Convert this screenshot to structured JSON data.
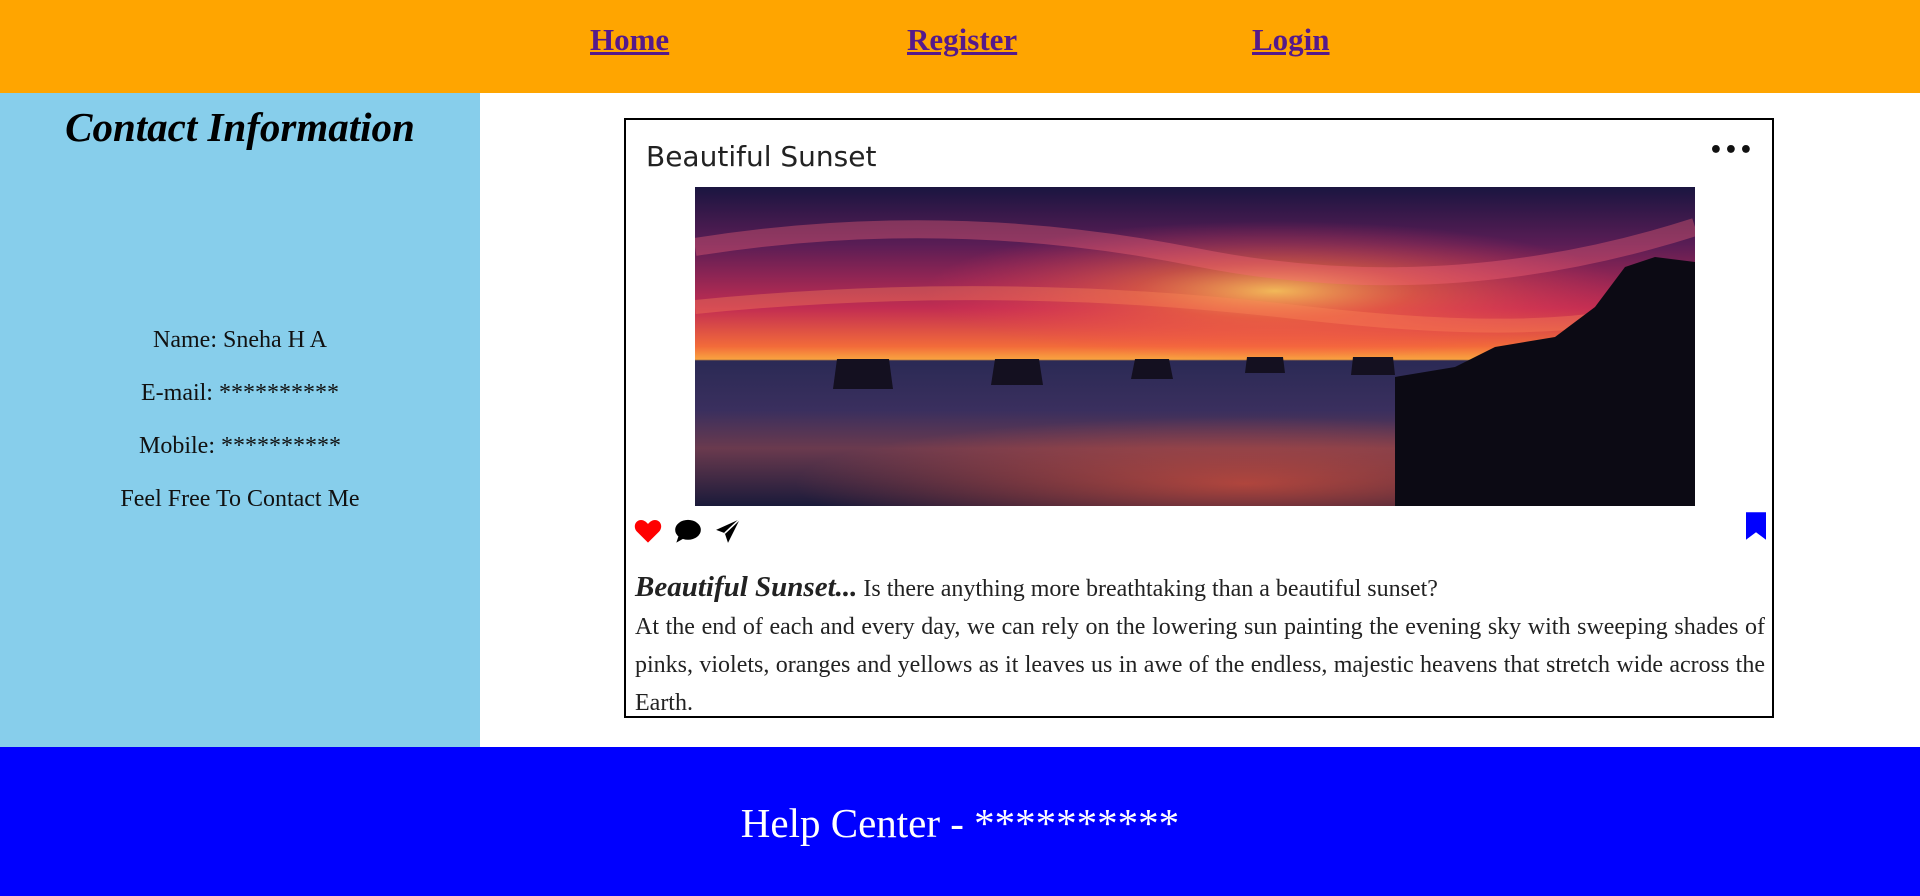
{
  "nav": {
    "home": "Home",
    "register": "Register",
    "login": "Login"
  },
  "sidebar": {
    "title": "Contact Information",
    "name": "Name: Sneha H A",
    "email": "E-mail: **********",
    "mobile": "Mobile: **********",
    "note": "Feel Free To Contact Me"
  },
  "post": {
    "title": "Beautiful Sunset",
    "menu_icon": "ellipsis-icon",
    "image_alt": "sunset over the sea",
    "actions": [
      "heart-icon",
      "comment-icon",
      "share-icon"
    ],
    "bookmark_icon": "bookmark-icon",
    "caption_lead": "Beautiful Sunset...",
    "caption_question": " Is there anything more breathtaking than a beautiful sunset?",
    "caption_body": "At the end of each and every day, we can rely on the lowering sun painting the evening sky with sweeping shades of pinks, violets, oranges and yellows as it leaves us in awe of the endless, majestic heavens that stretch wide across the Earth."
  },
  "footer": {
    "text": "Help Center - **********"
  },
  "colors": {
    "nav_bg": "#ffa500",
    "sidebar_bg": "#87ceeb",
    "footer_bg": "#0000ff",
    "link": "#551a8b",
    "heart": "#ff0000",
    "bookmark": "#0000ff"
  }
}
